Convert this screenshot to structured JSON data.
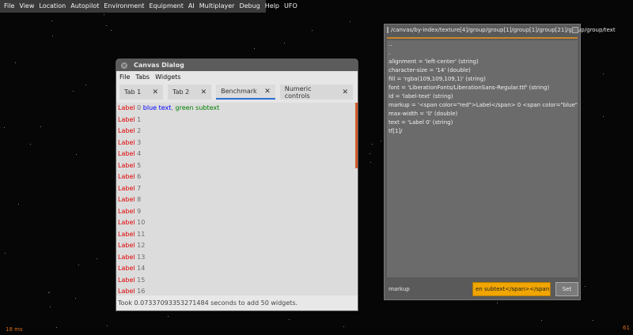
{
  "menubar": {
    "items": [
      "File",
      "View",
      "Location",
      "Autopilot",
      "Environment",
      "Equipment",
      "AI",
      "Multiplayer",
      "Debug",
      "Help",
      "UFO"
    ]
  },
  "canvas_dialog": {
    "title": "Canvas Dialog",
    "close_glyph": "×",
    "menu": [
      "File",
      "Tabs",
      "Widgets"
    ],
    "tabs": [
      {
        "label": "Tab 1",
        "close": "✕",
        "active": false
      },
      {
        "label": "Tab 2",
        "close": "✕",
        "active": false
      },
      {
        "label": "Benchmark",
        "close": "✕",
        "active": true
      },
      {
        "label": "Numeric controls",
        "close": "✕",
        "active": false
      }
    ],
    "first_row": {
      "word": "Label",
      "num": "0",
      "blue": "blue text",
      "sep": ",",
      "green": "green subtext"
    },
    "rows": [
      {
        "word": "Label",
        "num": "1"
      },
      {
        "word": "Label",
        "num": "2"
      },
      {
        "word": "Label",
        "num": "3"
      },
      {
        "word": "Label",
        "num": "4"
      },
      {
        "word": "Label",
        "num": "5"
      },
      {
        "word": "Label",
        "num": "6"
      },
      {
        "word": "Label",
        "num": "7"
      },
      {
        "word": "Label",
        "num": "8"
      },
      {
        "word": "Label",
        "num": "9"
      },
      {
        "word": "Label",
        "num": "10"
      },
      {
        "word": "Label",
        "num": "11"
      },
      {
        "word": "Label",
        "num": "12"
      },
      {
        "word": "Label",
        "num": "13"
      },
      {
        "word": "Label",
        "num": "14"
      },
      {
        "word": "Label",
        "num": "15"
      },
      {
        "word": "Label",
        "num": "16"
      }
    ],
    "status": "Took 0.07337093353271484 seconds to add 50 widgets."
  },
  "property_window": {
    "title": "/canvas/by-index/texture[4]/group/group[1]/group[1]/group[21]/group/group/text",
    "lines": [
      "..",
      ".",
      "alignment = 'left-center' (string)",
      "character-size = '14' (double)",
      "fill = 'rgba(109,109,109,1)' (string)",
      "font = 'LiberationFonts/LiberationSans-Regular.ttf' (string)",
      "id = 'label-text' (string)",
      "markup = '<span color=\"red\">Label</span> 0 <span color=\"blue\">blu...",
      "max-width = '0' (double)",
      "text = 'Label 0' (string)",
      "tf[1]/"
    ],
    "footer_label": "markup",
    "input_value": "en subtext</span></span>",
    "set_label": "Set"
  },
  "hud": {
    "frame_time": "18 ms",
    "fps": "61"
  },
  "colors": {
    "label_red": "#e00000",
    "blue_text": "#0000ff",
    "green_text": "#008000",
    "accent_tab": "#2c6fd0",
    "input_orange": "#f0a500"
  }
}
